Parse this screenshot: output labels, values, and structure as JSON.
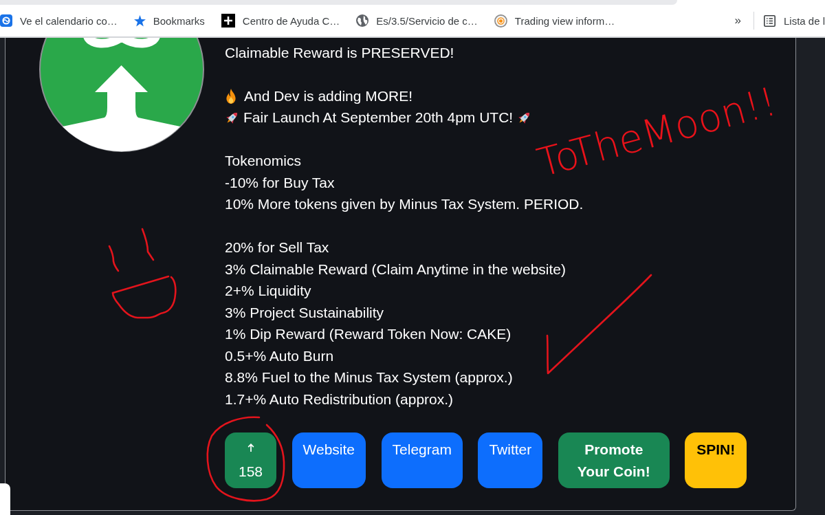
{
  "bookmarks_bar": {
    "items": [
      {
        "label": "Ve el calendario co…"
      },
      {
        "label": "Bookmarks"
      },
      {
        "label": "Centro de Ayuda C…"
      },
      {
        "label": "Es/3.5/Servicio de c…"
      },
      {
        "label": "Trading view inform…"
      }
    ],
    "overflow": "»",
    "reading_list": "Lista de l"
  },
  "description": [
    {
      "lines": [
        {
          "text": "Claimable Reward is PRESERVED!",
          "kind": "plain"
        }
      ]
    },
    {
      "lines": [
        {
          "text": "And Dev is adding MORE!",
          "kind": "hot"
        },
        {
          "text": "Fair Launch At September 20th 4pm UTC!",
          "kind": "launch"
        }
      ]
    },
    {
      "lines": [
        {
          "text": "Tokenomics",
          "kind": "plain"
        },
        {
          "text": "-10% for Buy Tax",
          "kind": "plain"
        },
        {
          "text": "10% More tokens given by Minus Tax System. PERIOD.",
          "kind": "plain"
        }
      ]
    },
    {
      "lines": [
        {
          "text": "20% for Sell Tax",
          "kind": "plain"
        },
        {
          "text": "3% Claimable Reward (Claim Anytime in the website)",
          "kind": "plain"
        },
        {
          "text": "2+% Liquidity",
          "kind": "plain"
        },
        {
          "text": "3% Project Sustainability",
          "kind": "plain"
        },
        {
          "text": "1% Dip Reward (Reward Token Now: CAKE)",
          "kind": "plain"
        },
        {
          "text": "0.5+% Auto Burn",
          "kind": "plain"
        },
        {
          "text": "8.8% Fuel to the Minus Tax System (approx.)",
          "kind": "plain"
        },
        {
          "text": "1.7+% Auto Redistribution (approx.)",
          "kind": "plain"
        }
      ]
    }
  ],
  "buttons": [
    {
      "kind": "vote",
      "label": "158"
    },
    {
      "kind": "link",
      "label": "Website"
    },
    {
      "kind": "link",
      "label": "Telegram"
    },
    {
      "kind": "link",
      "label": "Twitter"
    },
    {
      "kind": "promote",
      "label": "Promote Your Coin!"
    },
    {
      "kind": "spin",
      "label": "SPIN!"
    }
  ],
  "annotations": {
    "handwriting": "ToTheMoon!!"
  }
}
